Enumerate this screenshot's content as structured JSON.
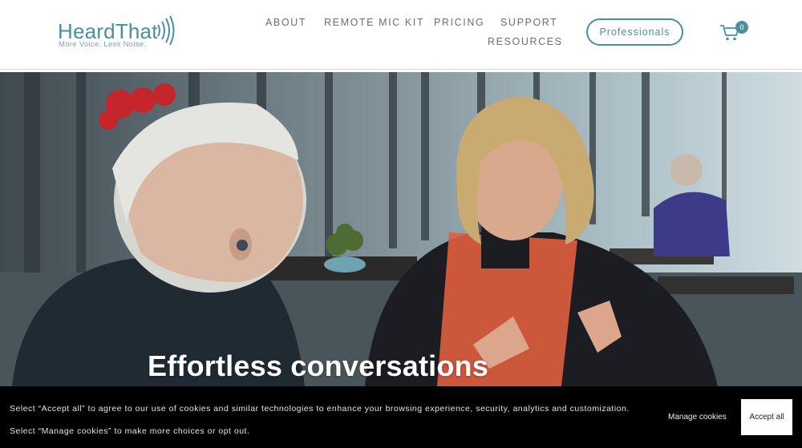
{
  "brand": {
    "name": "HeardThat",
    "tagline": "More Voice. Less Noise.",
    "accent_color": "#4b8fa0"
  },
  "nav": {
    "items": [
      {
        "label": "ABOUT"
      },
      {
        "label": "REMOTE MIC KIT"
      },
      {
        "label": "PRICING"
      },
      {
        "label": "SUPPORT"
      },
      {
        "label": "RESOURCES"
      }
    ],
    "professionals_label": "Professionals",
    "cart_icon": "shopping-cart-icon",
    "cart_count": "0"
  },
  "hero": {
    "title": "Effortless conversations",
    "image_subject": "two people talking at a cafe table, one wearing an earbud"
  },
  "cookie_banner": {
    "message": "Select “Accept all” to agree to our use of cookies and similar technologies to enhance your browsing experience, security, analytics and customization. Select “Manage cookies” to make more choices or opt out.",
    "manage_label": "Manage cookies",
    "accept_label": "Accept all"
  }
}
